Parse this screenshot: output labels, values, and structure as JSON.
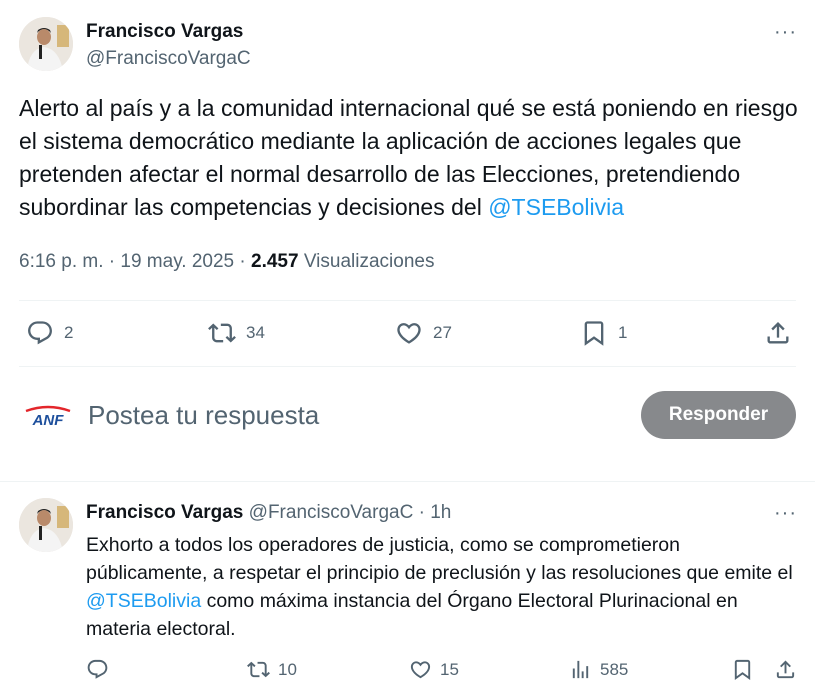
{
  "main_tweet": {
    "author_name": "Francisco Vargas",
    "author_handle": "@FranciscoVargaC",
    "more_label": "···",
    "text_part1": "Alerto al país y a la comunidad internacional qué se está poniendo en riesgo el sistema democrático mediante la aplicación de acciones legales que pretenden afectar el normal desarrollo de las Elecciones, pretendiendo subordinar las competencias y decisiones del ",
    "mention": "@TSEBolivia",
    "time": "6:16 p. m.",
    "sep1": " · ",
    "date": "19 may. 2025",
    "sep2": " · ",
    "views_count": "2.457",
    "views_label": " Visualizaciones",
    "stats": {
      "replies": "2",
      "retweets": "34",
      "likes": "27",
      "bookmarks": "1"
    }
  },
  "reply_box": {
    "logo_text": "ANF",
    "placeholder": "Postea tu respuesta",
    "button_label": "Responder"
  },
  "reply_tweet": {
    "author_name": "Francisco Vargas",
    "author_handle": "@FranciscoVargaC",
    "time_sep": " · ",
    "time": "1h",
    "more_label": "···",
    "text_part1": "Exhorto a todos los operadores de justicia, como se comprometieron públicamente, a respetar el principio de preclusión y las resoluciones que emite el ",
    "mention": "@TSEBolivia",
    "text_part2": " como máxima instancia del Órgano Electoral Plurinacional en materia electoral.",
    "stats": {
      "replies": "",
      "retweets": "10",
      "likes": "15",
      "views": "585"
    }
  },
  "colors": {
    "text": "#0f1419",
    "secondary": "#536471",
    "link": "#1d9bf0",
    "button_disabled": "#87898c",
    "divider": "#eff3f4"
  }
}
